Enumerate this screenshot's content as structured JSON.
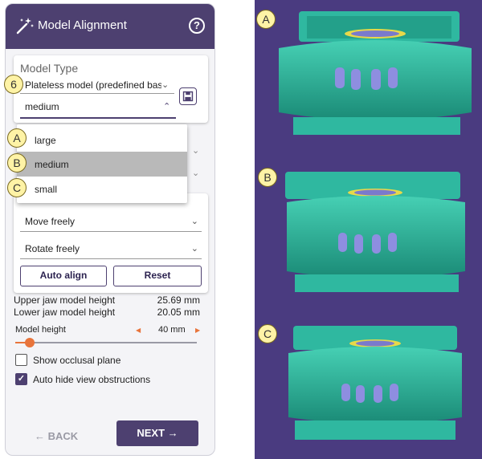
{
  "header": {
    "title": "Model Alignment",
    "help_glyph": "?"
  },
  "model_type": {
    "label": "Model Type",
    "type_value": "Plateless model (predefined base)",
    "size_value": "medium",
    "dropdown_options": [
      "large",
      "medium",
      "small"
    ],
    "selected_option": "medium"
  },
  "movement": {
    "move_value": "Move freely",
    "rotate_value": "Rotate freely",
    "auto_align_label": "Auto align",
    "reset_label": "Reset"
  },
  "heights": {
    "upper_label": "Upper jaw model height",
    "upper_value": "25.69 mm",
    "lower_label": "Lower jaw model height",
    "lower_value": "20.05 mm"
  },
  "slider": {
    "label": "Model height",
    "value": "40 mm",
    "fraction": 0.08
  },
  "options": {
    "occlusal_label": "Show occlusal plane",
    "occlusal_checked": false,
    "obstructions_label": "Auto hide view obstructions",
    "obstructions_checked": true
  },
  "nav": {
    "back_label": "BACK",
    "next_label": "NEXT"
  },
  "badges": {
    "step": "6",
    "a": "A",
    "b": "B",
    "c": "C"
  },
  "colors": {
    "accent": "#4d4070",
    "slider": "#e8743b",
    "model": "#2fb8a0",
    "background": "#4a3b80",
    "teeth": "#8e8ee0"
  }
}
